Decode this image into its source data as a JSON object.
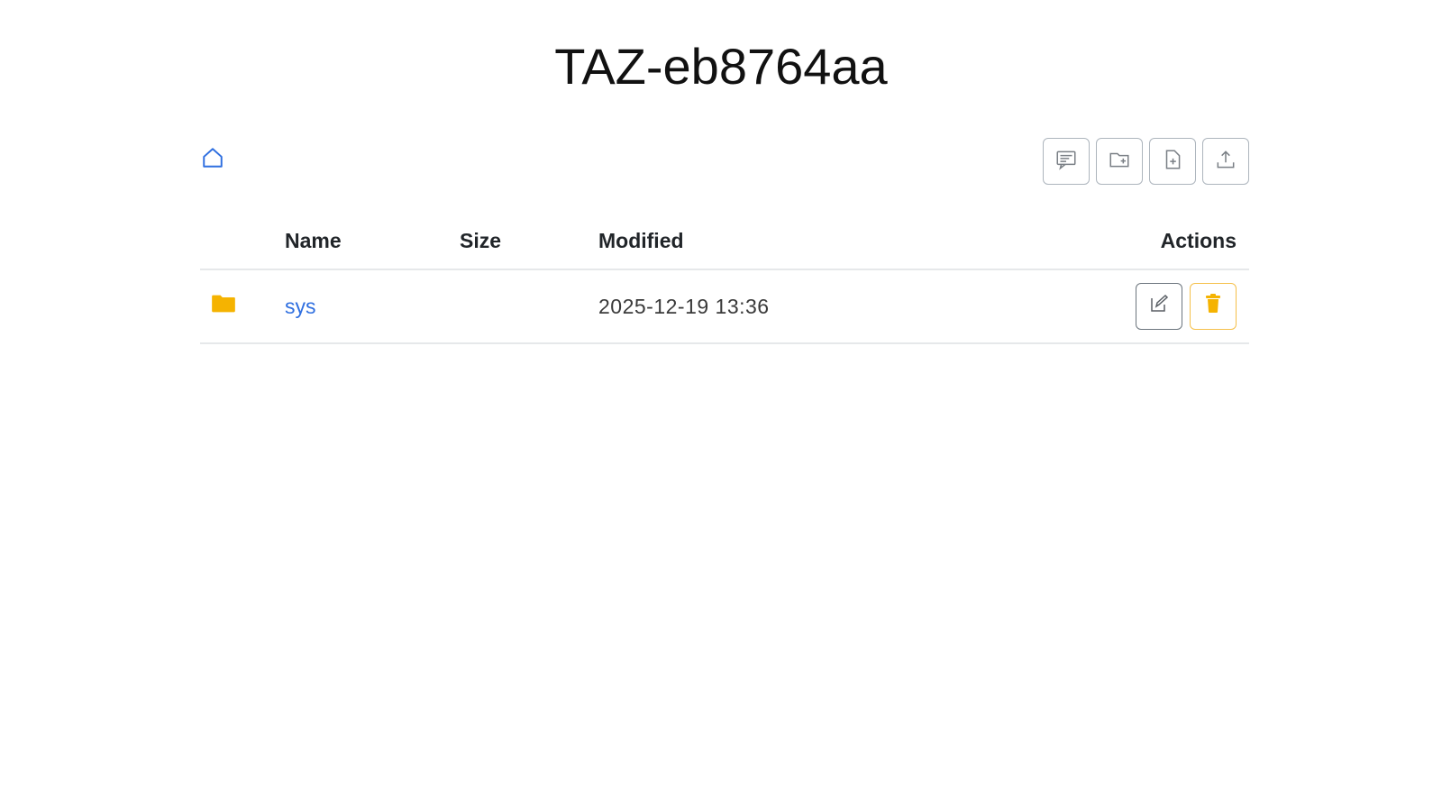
{
  "page": {
    "title": "TAZ-eb8764aa"
  },
  "toolbar": {
    "home_icon": "home-icon",
    "buttons": [
      {
        "name": "terminal-button",
        "icon": "terminal-icon"
      },
      {
        "name": "new-folder-button",
        "icon": "folder-plus-icon"
      },
      {
        "name": "new-file-button",
        "icon": "file-plus-icon"
      },
      {
        "name": "upload-button",
        "icon": "upload-icon"
      }
    ]
  },
  "table": {
    "headers": {
      "name": "Name",
      "size": "Size",
      "modified": "Modified",
      "actions": "Actions"
    },
    "rows": [
      {
        "type_icon": "folder-icon",
        "name": "sys",
        "size": "",
        "modified": "2025-12-19 13:36",
        "actions": [
          "edit-icon",
          "trash-icon"
        ]
      }
    ]
  },
  "colors": {
    "link": "#2f6fe0",
    "folder": "#f5b301",
    "delete": "#f5b301",
    "border": "#adb5bd"
  }
}
